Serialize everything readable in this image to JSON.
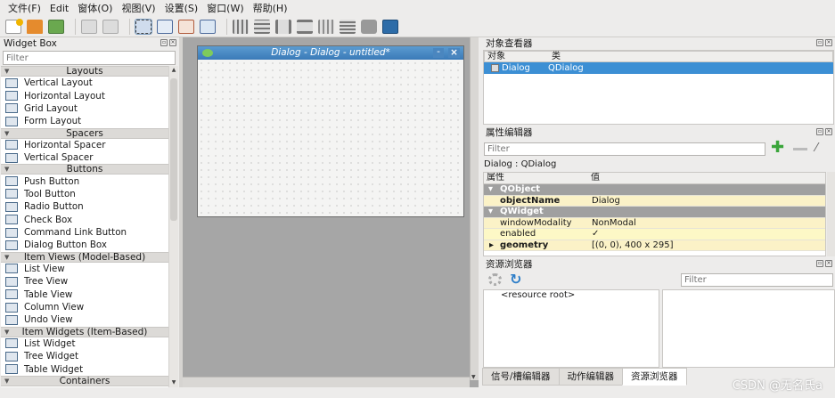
{
  "menubar": [
    "文件(F)",
    "Edit",
    "窗体(O)",
    "视图(V)",
    "设置(S)",
    "窗口(W)",
    "帮助(H)"
  ],
  "widget_box": {
    "title": "Widget Box",
    "filter_placeholder": "Filter",
    "sections": [
      {
        "label": "Layouts",
        "items": [
          "Vertical Layout",
          "Horizontal Layout",
          "Grid Layout",
          "Form Layout"
        ]
      },
      {
        "label": "Spacers",
        "items": [
          "Horizontal Spacer",
          "Vertical Spacer"
        ]
      },
      {
        "label": "Buttons",
        "items": [
          "Push Button",
          "Tool Button",
          "Radio Button",
          "Check Box",
          "Command Link Button",
          "Dialog Button Box"
        ]
      },
      {
        "label": "Item Views (Model-Based)",
        "items": [
          "List View",
          "Tree View",
          "Table View",
          "Column View",
          "Undo View"
        ]
      },
      {
        "label": "Item Widgets (Item-Based)",
        "items": [
          "List Widget",
          "Tree Widget",
          "Table Widget"
        ]
      },
      {
        "label": "Containers",
        "items": []
      }
    ]
  },
  "dialog": {
    "title": "Dialog - Dialog - untitled*"
  },
  "object_inspector": {
    "title": "对象查看器",
    "col_object": "对象",
    "col_class": "类",
    "row": {
      "object": "Dialog",
      "class": "QDialog"
    }
  },
  "property_editor": {
    "title": "属性编辑器",
    "filter_placeholder": "Filter",
    "context": "Dialog : QDialog",
    "col_property": "属性",
    "col_value": "值",
    "rows": [
      {
        "k": "QObject",
        "v": "",
        "type": "group"
      },
      {
        "k": "objectName",
        "v": "Dialog",
        "type": "bold"
      },
      {
        "k": "QWidget",
        "v": "",
        "type": "group"
      },
      {
        "k": "windowModality",
        "v": "NonModal",
        "type": "normal"
      },
      {
        "k": "enabled",
        "v": "✓",
        "type": "normal"
      },
      {
        "k": "geometry",
        "v": "[(0, 0), 400 x 295]",
        "type": "bold"
      }
    ]
  },
  "resource_browser": {
    "title": "资源浏览器",
    "filter_placeholder": "Filter",
    "root": "<resource root>"
  },
  "tabs": [
    "信号/槽编辑器",
    "动作编辑器",
    "资源浏览器"
  ],
  "watermark": "CSDN @无名氏a",
  "colors": {
    "accent": "#3a7ab8",
    "selection": "#3c8fd4",
    "group": "#a0a0a0",
    "highlight": "#fdf8c6"
  }
}
